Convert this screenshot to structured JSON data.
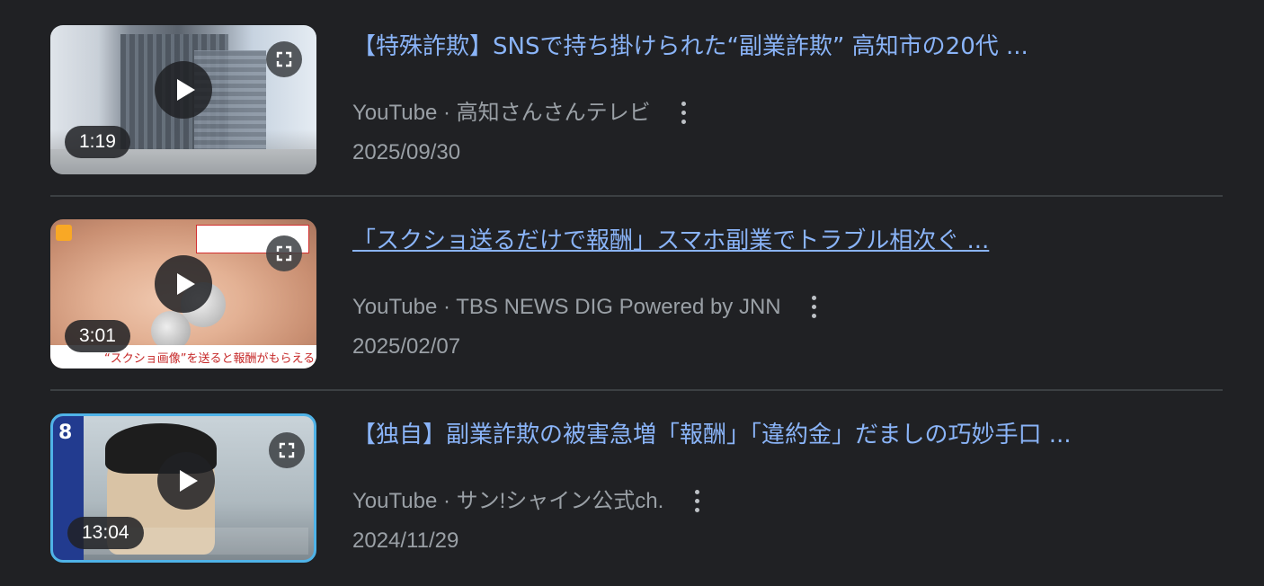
{
  "results": [
    {
      "title": "【特殊詐欺】SNSで持ち掛けられた“副業詐欺” 高知市の20代 ...",
      "source": "YouTube",
      "separator": " · ",
      "channel": "高知さんさんテレビ",
      "date": "2025/09/30",
      "duration": "1:19",
      "icon_play": "play-icon",
      "icon_expand": "expand-icon",
      "icon_more": "more-vert-icon"
    },
    {
      "title": "「スクショ送るだけで報酬」スマホ副業でトラブル相次ぐ ...",
      "source": "YouTube",
      "separator": " · ",
      "channel": "TBS NEWS DIG Powered by JNN",
      "date": "2025/02/07",
      "duration": "3:01",
      "thumb_caption": "“スクショ画像”を送ると報酬がもらえる",
      "icon_play": "play-icon",
      "icon_expand": "expand-icon",
      "icon_more": "more-vert-icon"
    },
    {
      "title": "【独自】副業詐欺の被害急増「報酬」「違約金」だましの巧妙手口 ...",
      "source": "YouTube",
      "separator": " · ",
      "channel": "サン!シャイン公式ch.",
      "date": "2024/11/29",
      "duration": "13:04",
      "thumb_badge": "8",
      "icon_play": "play-icon",
      "icon_expand": "expand-icon",
      "icon_more": "more-vert-icon"
    }
  ],
  "colors": {
    "background": "#202124",
    "title_link": "#8ab4f8",
    "meta_text": "#9aa0a6",
    "divider": "#3c4043",
    "thumb3_border": "#4fb3e8"
  }
}
